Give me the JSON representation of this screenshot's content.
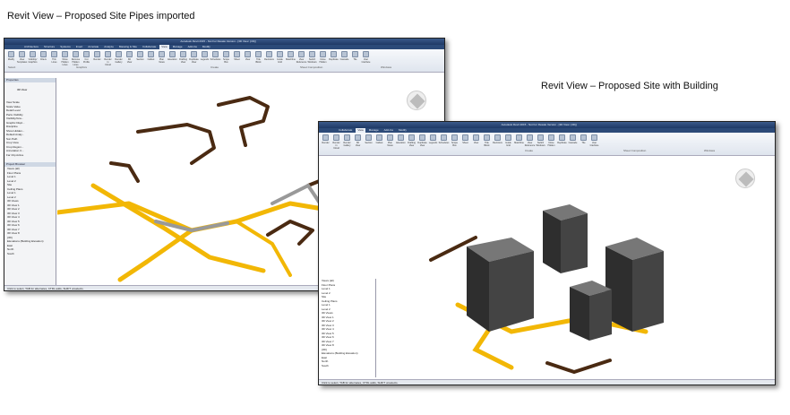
{
  "captions": {
    "pipes": "Revit View – Proposed Site Pipes imported",
    "building": "Revit View – Proposed Site with Building"
  },
  "revit": {
    "title": "Autodesk Revit 2015 - Not For Resale Version - [3D View: {3D}]",
    "tabs": [
      "Architecture",
      "Structure",
      "Systems",
      "Insert",
      "Annotate",
      "Analyze",
      "Massing & Site",
      "Collaborate",
      "View",
      "Manage",
      "Add-Ins",
      "Modify"
    ],
    "active_tab": "View",
    "ribbon_buttons": [
      "Modify",
      "View Templates",
      "Visibility/ Graphics",
      "Filters",
      "Thin Lines",
      "Show Hidden Lines",
      "Remove Hidden Lines",
      "Cut Profile",
      "Render",
      "Render in Cloud",
      "Render Gallery",
      "3D View",
      "Section",
      "Callout",
      "Plan Views",
      "Elevation",
      "Drafting View",
      "Duplicate View",
      "Legends",
      "Schedules",
      "Scope Box",
      "Sheet",
      "View",
      "Title Block",
      "Revisions",
      "Guide Grid",
      "Matchline",
      "View Reference",
      "Switch Windows",
      "Close Hidden",
      "Replicate",
      "Cascade",
      "Tile",
      "User Interface"
    ],
    "panels": [
      "Select",
      "Graphics",
      "Create",
      "Sheet Composition",
      "Windows"
    ],
    "properties_title": "Properties",
    "properties_type": "3D View",
    "properties_rows": [
      "View Scale",
      "Scale Value",
      "Detail Level",
      "Parts Visibility",
      "Visibility/Gra...",
      "Graphic Displ...",
      "Discipline",
      "Show Hidden...",
      "Default Analy...",
      "Sun Path",
      "Crop View",
      "Crop Region...",
      "Annotation C...",
      "Far Clip Active"
    ],
    "browser_title": "Project Browser",
    "browser_items": [
      "Views (all)",
      "Floor Plans",
      "Level 1",
      "Level 2",
      "Site",
      "Ceiling Plans",
      "Level 1",
      "Level 2",
      "3D Views",
      "3D View 1",
      "3D View 2",
      "3D View 3",
      "3D View 4",
      "3D View 5",
      "3D View 6",
      "3D View 7",
      "3D View 8",
      "{3D}",
      "Elevations (Building Elevation)",
      "East",
      "North",
      "South"
    ],
    "status": "Click to select, TAB for alternates, CTRL adds, SHIFT unselects.",
    "model": "Main Model"
  },
  "colors": {
    "pipe": "#f2b705",
    "pipe_dark": "#4a2a12",
    "building": "#3a3a3a",
    "ribbon": "#2c4a78"
  }
}
